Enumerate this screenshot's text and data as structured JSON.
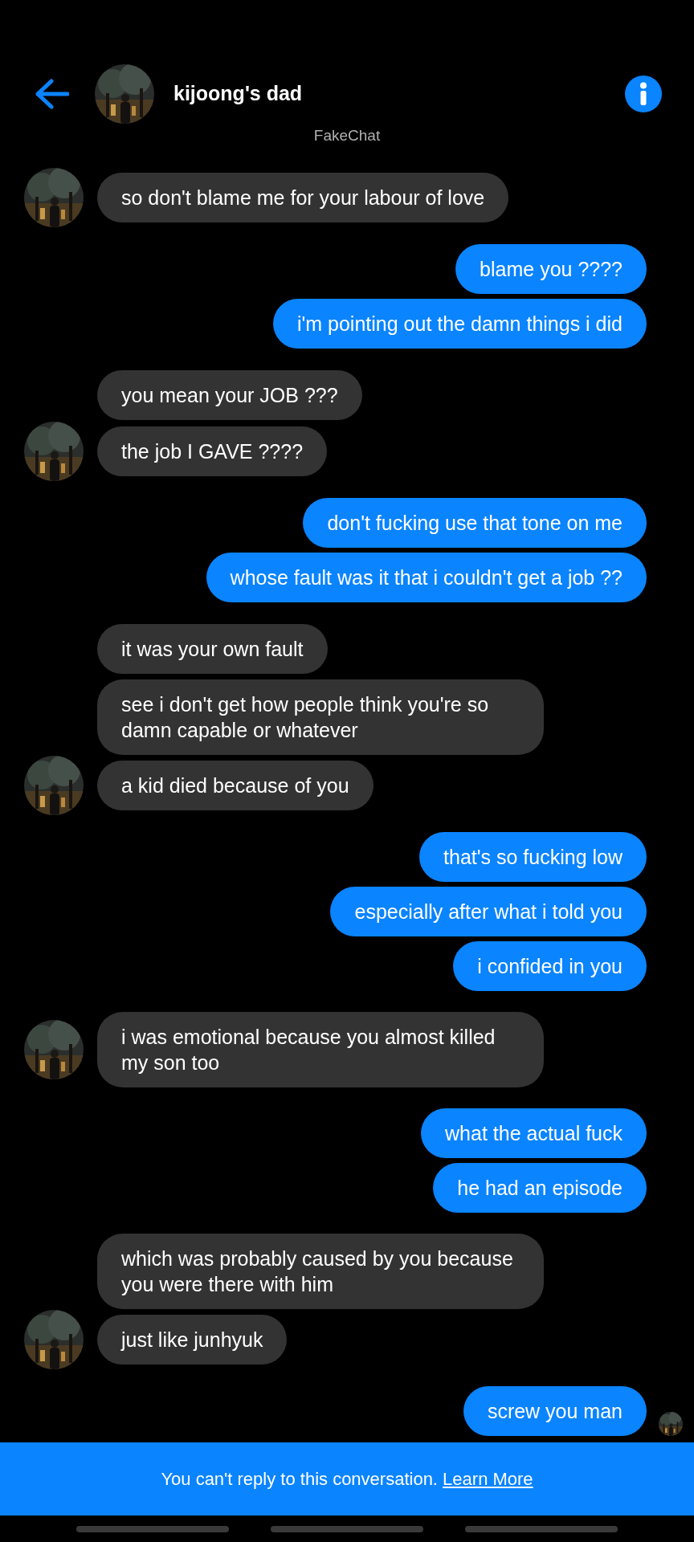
{
  "header": {
    "contact_name": "kijoong's dad",
    "subtitle": "FakeChat"
  },
  "groups": [
    {
      "kind": "received",
      "messages": [
        "so don't blame me for your labour of love"
      ]
    },
    {
      "kind": "sent",
      "seen": false,
      "messages": [
        "blame you ????",
        "i'm pointing out the damn things i did"
      ]
    },
    {
      "kind": "received",
      "messages": [
        "you mean your JOB ???",
        "the job I GAVE ????"
      ]
    },
    {
      "kind": "sent",
      "seen": false,
      "messages": [
        "don't fucking use that tone on me",
        "whose fault was it that i couldn't get a job ??"
      ]
    },
    {
      "kind": "received",
      "messages": [
        "it was your own fault",
        "see i don't get how people think you're so damn capable or whatever",
        "a kid died because of you"
      ]
    },
    {
      "kind": "sent",
      "seen": false,
      "messages": [
        "that's so fucking low",
        "especially after what i told you",
        "i confided in you"
      ]
    },
    {
      "kind": "received",
      "messages": [
        "i was emotional because you almost killed my son too"
      ]
    },
    {
      "kind": "sent",
      "seen": false,
      "messages": [
        "what the actual fuck",
        "he had an episode"
      ]
    },
    {
      "kind": "received",
      "messages": [
        "which was probably caused by you because you were there with him",
        "just like junhyuk"
      ]
    },
    {
      "kind": "sent",
      "seen": true,
      "messages": [
        "screw you man"
      ]
    }
  ],
  "banner": {
    "text": "You can't reply to this conversation.",
    "link": "Learn More"
  }
}
